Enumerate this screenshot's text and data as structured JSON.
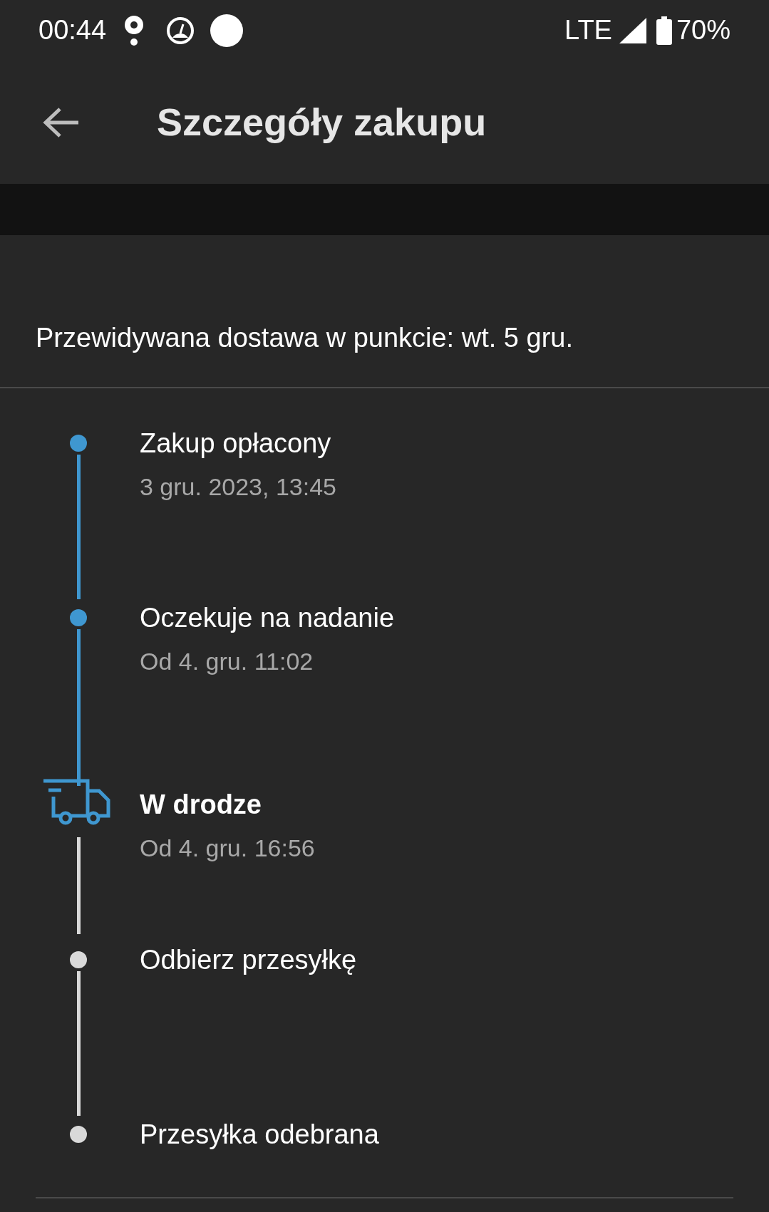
{
  "status_bar": {
    "time": "00:44",
    "network": "LTE",
    "battery": "70%"
  },
  "app_bar": {
    "title": "Szczegóły zakupu"
  },
  "delivery_estimate": "Przewidywana dostawa w punkcie: wt. 5 gru.",
  "timeline": [
    {
      "kind": "dot",
      "completed": true,
      "current": false,
      "title": "Zakup opłacony",
      "subtitle": "3 gru. 2023, 13:45"
    },
    {
      "kind": "dot",
      "completed": true,
      "current": false,
      "title": "Oczekuje na nadanie",
      "subtitle": "Od 4. gru. 11:02"
    },
    {
      "kind": "truck",
      "completed": false,
      "current": true,
      "title": "W drodze",
      "subtitle": "Od 4. gru. 16:56"
    },
    {
      "kind": "dot",
      "completed": false,
      "current": false,
      "title": "Odbierz przesyłkę"
    },
    {
      "kind": "dot",
      "completed": false,
      "current": false,
      "title": "Przesyłka odebrana"
    }
  ]
}
